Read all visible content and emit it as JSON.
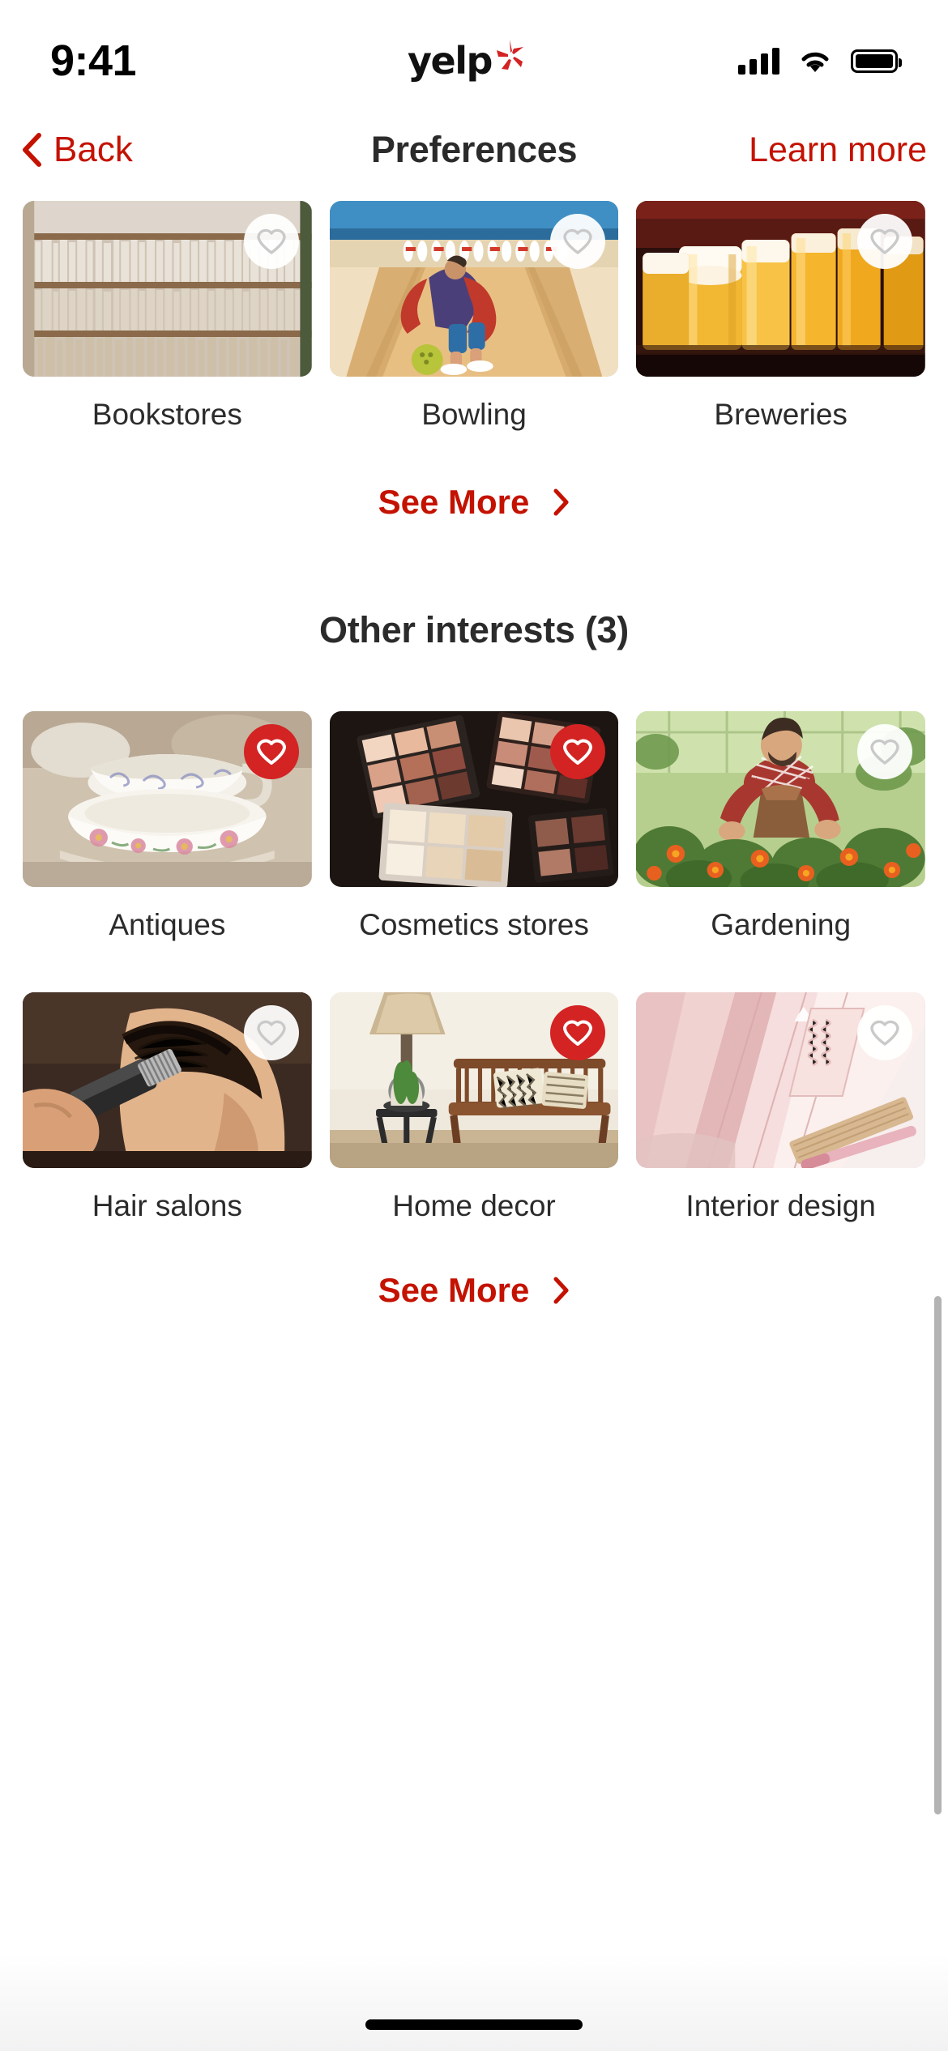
{
  "status_bar": {
    "time": "9:41",
    "brand": "yelp",
    "brand_icon": "yelp-burst-icon",
    "signal_icon": "cellular-signal-icon",
    "wifi_icon": "wifi-icon",
    "battery_icon": "battery-full-icon"
  },
  "nav": {
    "back_label": "Back",
    "back_icon": "chevron-left-icon",
    "title": "Preferences",
    "learn_more_label": "Learn more"
  },
  "sections": [
    {
      "heading": null,
      "rows": [
        [
          {
            "label": "Bookstores",
            "selected": false,
            "image": "bookstore-shelves"
          },
          {
            "label": "Bowling",
            "selected": false,
            "image": "bowling-lane"
          },
          {
            "label": "Breweries",
            "selected": false,
            "image": "beer-glasses"
          }
        ]
      ],
      "see_more_label": "See More",
      "see_more_icon": "chevron-right-icon"
    },
    {
      "heading": "Other interests (3)",
      "rows": [
        [
          {
            "label": "Antiques",
            "selected": true,
            "image": "antique-teacups"
          },
          {
            "label": "Cosmetics stores",
            "selected": true,
            "image": "makeup-palettes"
          },
          {
            "label": "Gardening",
            "selected": false,
            "image": "man-gardening"
          }
        ],
        [
          {
            "label": "Hair salons",
            "selected": false,
            "image": "barber-haircut"
          },
          {
            "label": "Home decor",
            "selected": true,
            "image": "living-room-bench"
          },
          {
            "label": "Interior design",
            "selected": false,
            "image": "pink-fabric-swatches"
          }
        ]
      ],
      "see_more_label": "See More",
      "see_more_icon": "chevron-right-icon"
    }
  ],
  "colors": {
    "brand_red": "#C41200",
    "heart_selected": "#D32323",
    "text_primary": "#2B2B2B",
    "background": "#FFFFFF"
  },
  "scrollbar": {
    "visible": true
  },
  "home_indicator": {
    "visible": true
  }
}
